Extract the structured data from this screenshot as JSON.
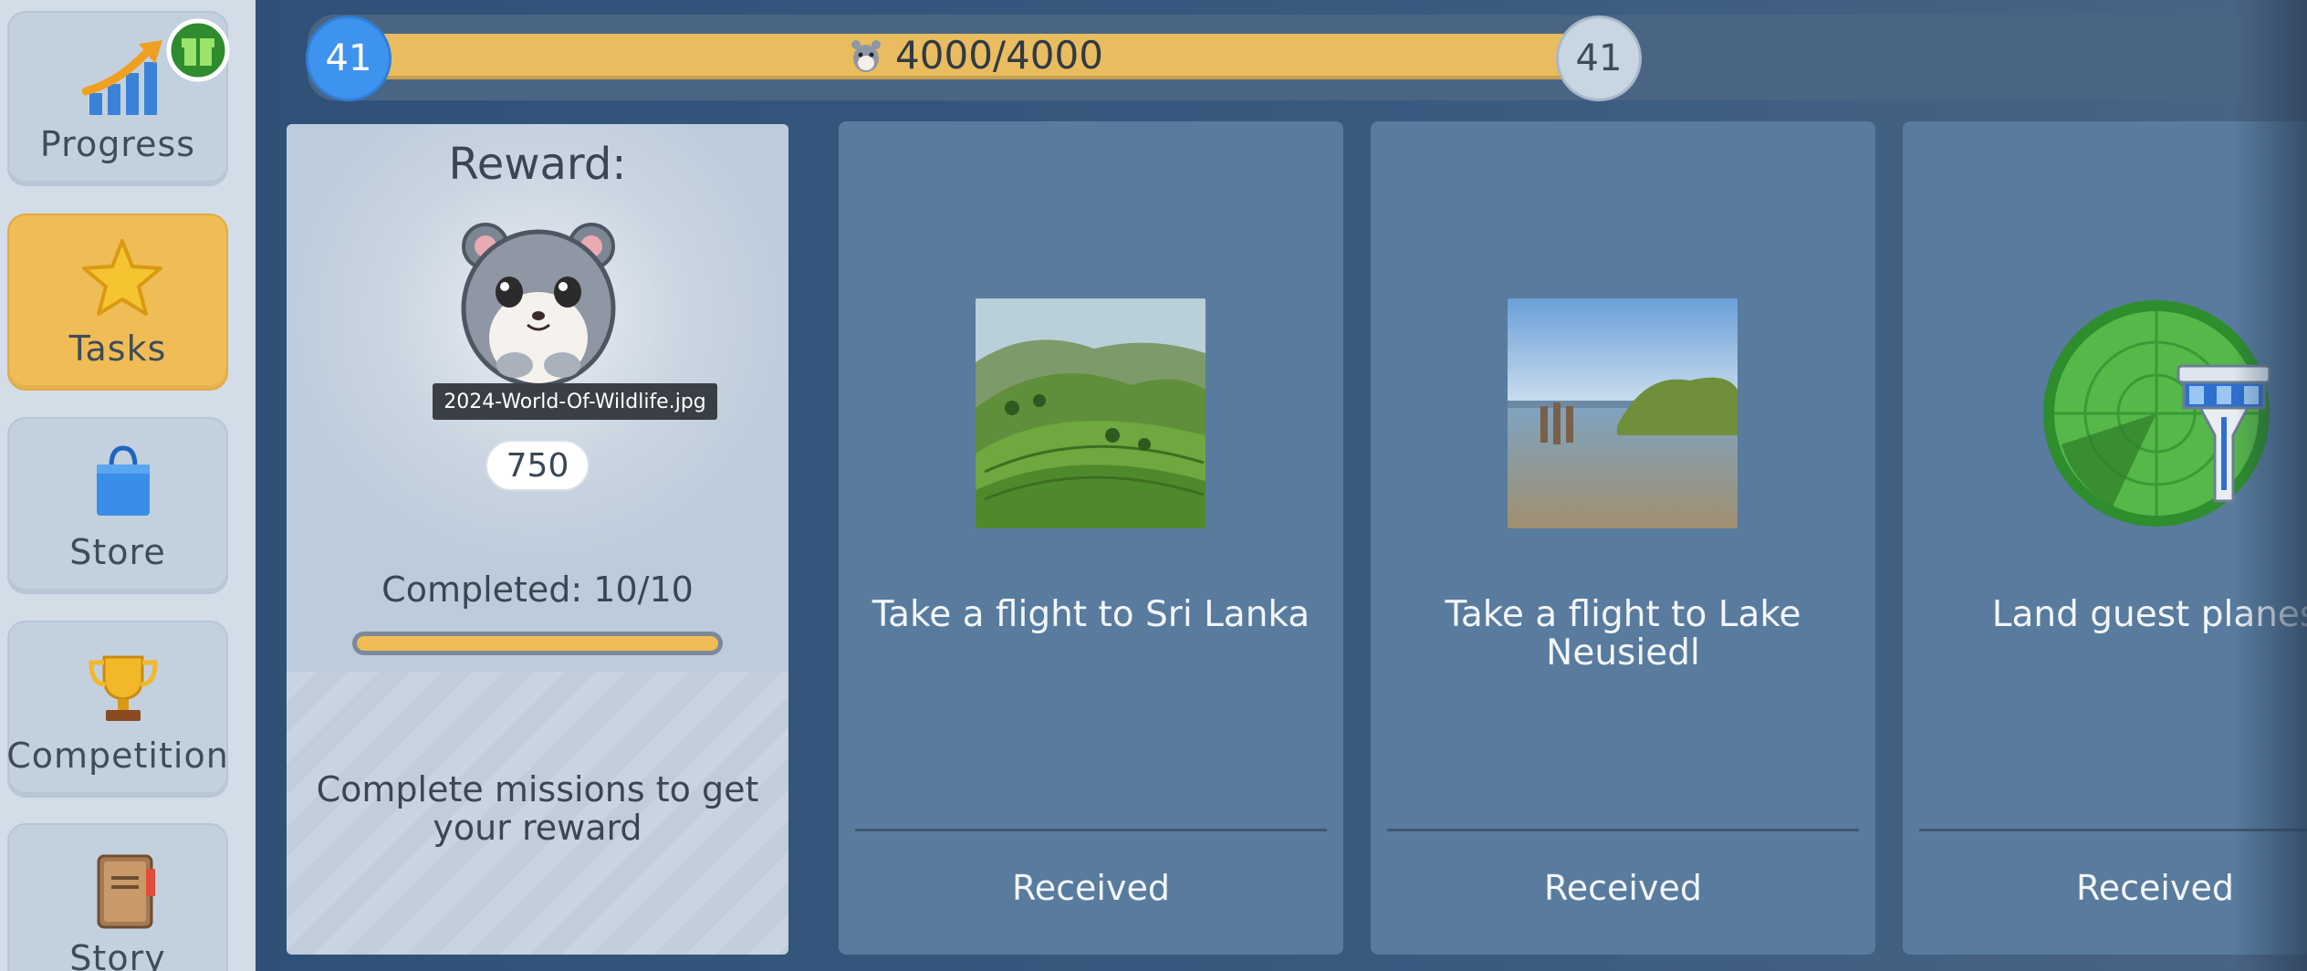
{
  "sidebar": {
    "items": [
      {
        "label": "Progress",
        "icon": "progress-chart-icon",
        "badge_icon": "gift-icon",
        "active": false
      },
      {
        "label": "Tasks",
        "icon": "star-icon",
        "active": true
      },
      {
        "label": "Store",
        "icon": "shopping-bag-icon",
        "active": false
      },
      {
        "label": "Competition",
        "icon": "trophy-icon",
        "active": false
      },
      {
        "label": "Story",
        "icon": "book-icon",
        "active": false
      }
    ]
  },
  "level_bar": {
    "current_level": "41",
    "next_level": "41",
    "xp_text": "4000/4000",
    "xp_fraction": 1.0,
    "icon": "hamster-icon"
  },
  "reward": {
    "title": "Reward:",
    "image_icon": "hamster-icon",
    "file_label": "2024-World-Of-Wildlife.jpg",
    "amount": "750",
    "completed": "Completed: 10/10",
    "progress_fraction": 1.0,
    "description": "Complete missions to get your reward"
  },
  "tasks": [
    {
      "title": "Take a flight to Sri Lanka",
      "status": "Received",
      "image": "tea-plantation-photo"
    },
    {
      "title": "Take a flight to Lake Neusiedl",
      "status": "Received",
      "image": "lake-photo"
    },
    {
      "title": "Land guest planes",
      "status": "Received",
      "image": "radar-tower-icon"
    }
  ],
  "colors": {
    "active_accent": "#f0bc55",
    "level_blue": "#3e93ee",
    "card_bg": "#587b9e"
  }
}
